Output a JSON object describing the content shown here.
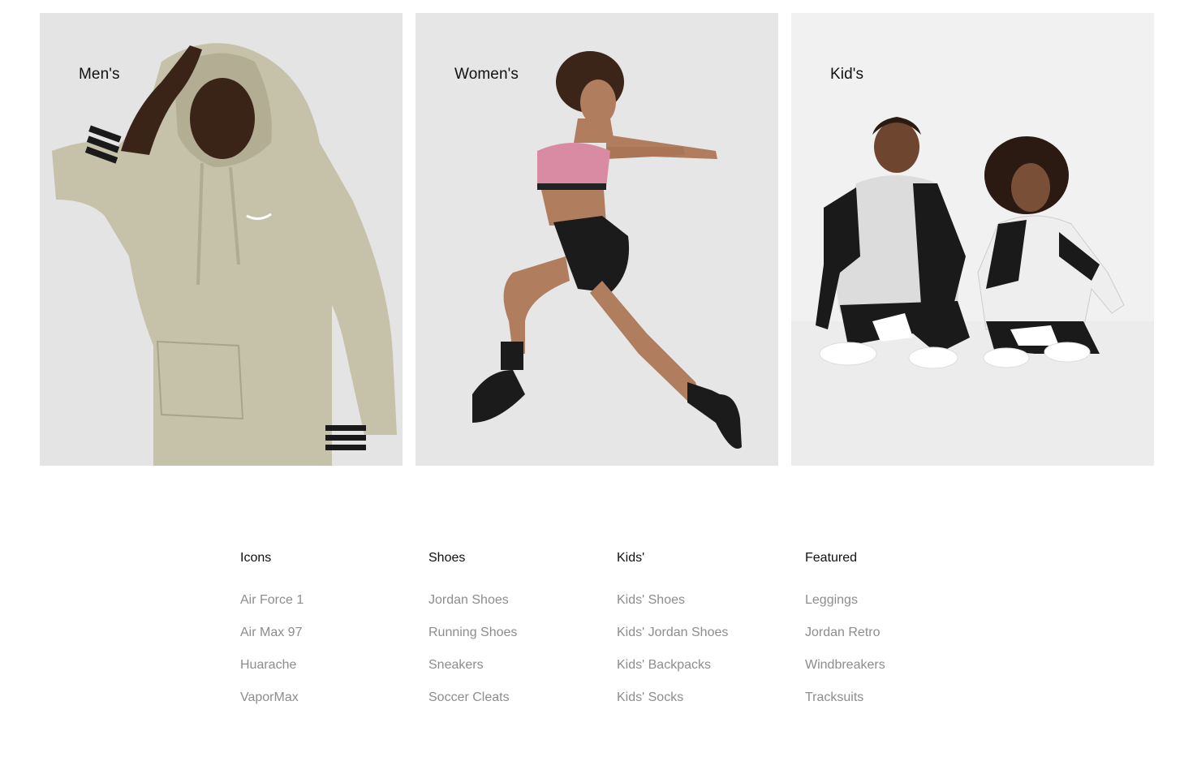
{
  "categories": [
    {
      "label": "Men's",
      "image_icon": "men-hoodie-photo",
      "bg": "#e5e5e5"
    },
    {
      "label": "Women's",
      "image_icon": "women-training-photo",
      "bg": "#e8e8e8"
    },
    {
      "label": "Kid's",
      "image_icon": "kids-tracksuit-photo",
      "bg": "#f2f2f2"
    }
  ],
  "footer_nav": {
    "columns": [
      {
        "heading": "Icons",
        "links": [
          "Air Force 1",
          "Air Max 97",
          "Huarache",
          "VaporMax"
        ]
      },
      {
        "heading": "Shoes",
        "links": [
          "Jordan Shoes",
          "Running Shoes",
          "Sneakers",
          "Soccer Cleats"
        ]
      },
      {
        "heading": "Kids'",
        "links": [
          "Kids' Shoes",
          "Kids' Jordan Shoes",
          "Kids' Backpacks",
          "Kids' Socks"
        ]
      },
      {
        "heading": "Featured",
        "links": [
          "Leggings",
          "Jordan Retro",
          "Windbreakers",
          "Tracksuits"
        ]
      }
    ]
  },
  "colors": {
    "heading_text": "#111111",
    "link_text": "#8d8d8d",
    "page_bg": "#ffffff"
  }
}
